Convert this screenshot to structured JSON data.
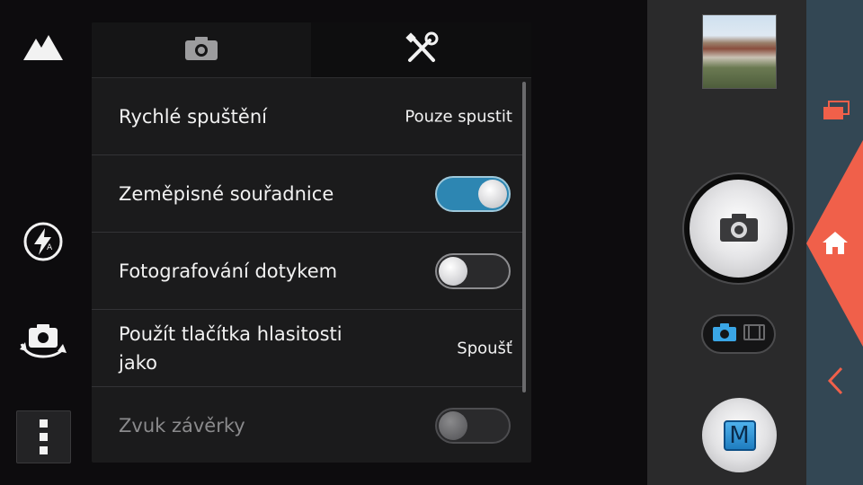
{
  "left_toolbar": {
    "icons": [
      "scene-mountain-icon",
      "flash-auto-icon",
      "switch-camera-icon",
      "menu-dots-icon"
    ]
  },
  "settings": {
    "tabs": [
      {
        "icon": "camera-icon",
        "selected": false
      },
      {
        "icon": "tools-icon",
        "selected": true
      }
    ],
    "rows": [
      {
        "label": "Rychlé spuštění",
        "value": "Pouze spustit"
      },
      {
        "label": "Zeměpisné souřadnice",
        "toggle": "on"
      },
      {
        "label": "Fotografování dotykem",
        "toggle": "off"
      },
      {
        "label": "Použít tlačítka hlasitosti jako",
        "value": "Spoušť"
      },
      {
        "label": "Zvuk závěrky",
        "toggle": "off",
        "disabled": true
      }
    ]
  },
  "controls": {
    "shutter_icon": "camera-icon",
    "mode_switch": {
      "selected": "photo",
      "icons": [
        "camera-icon",
        "video-icon"
      ]
    },
    "mode_button_label": "M"
  },
  "navigation": {
    "icons": [
      "recent-apps-icon",
      "home-icon",
      "back-icon"
    ],
    "colors": {
      "strip": "#334754",
      "home": "#f0604a",
      "accent": "#2d86b2"
    }
  }
}
